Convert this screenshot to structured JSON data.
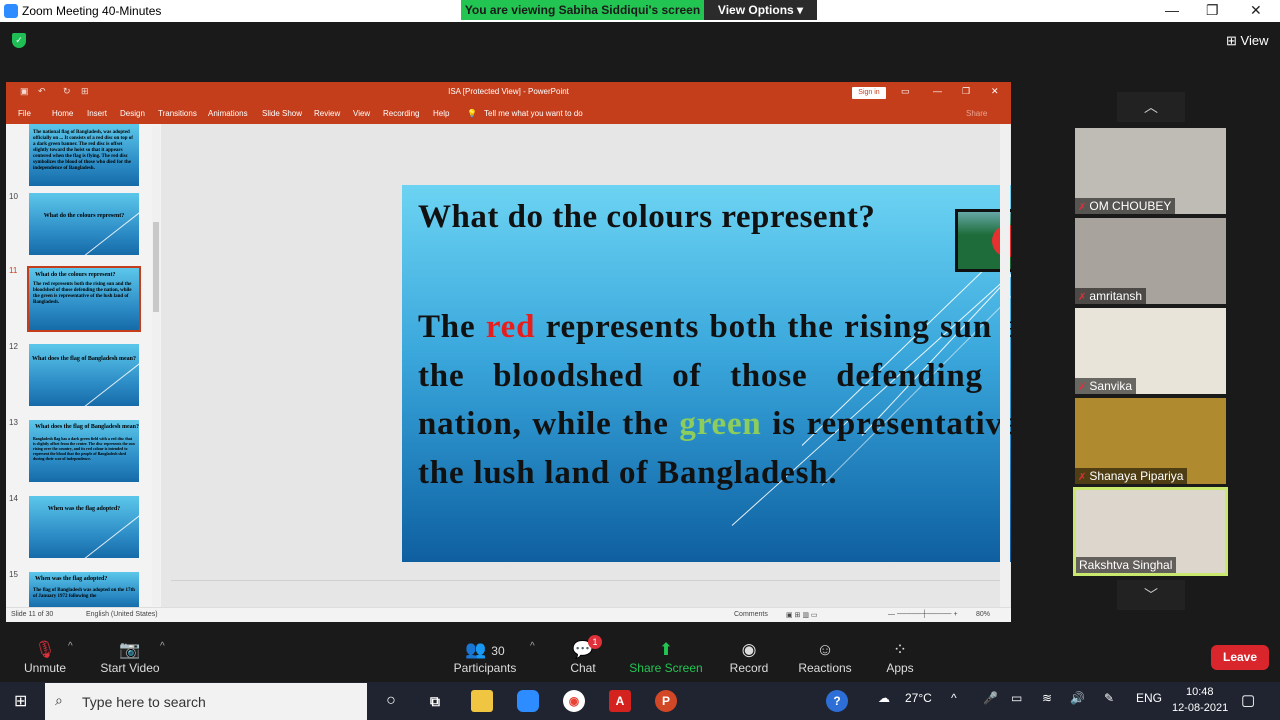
{
  "window": {
    "title": "Zoom Meeting 40-Minutes",
    "minimize": "—",
    "maximize": "❐",
    "close": "✕"
  },
  "share_banner": {
    "text": "You are viewing Sabiha Siddiqui's screen",
    "options": "View Options ▾"
  },
  "view_button": "View",
  "ppt": {
    "doc_title": "ISA [Protected View] - PowerPoint",
    "sign_in": "Sign in",
    "share": "Share",
    "menu": [
      "File",
      "Home",
      "Insert",
      "Design",
      "Transitions",
      "Animations",
      "Slide Show",
      "Review",
      "View",
      "Recording",
      "Help"
    ],
    "tell_me": "Tell me what you want to do",
    "thumbnails": [
      {
        "num": "",
        "title": "",
        "body": "The national flag of Bangladesh, was adopted officially on ... It consists of a red disc on top of a dark green banner. The red disc is offset slightly toward the hoist so that it appears centered when the flag is flying. The red disc symbolizes the blood of those who died for the independence of Bangladesh."
      },
      {
        "num": "10",
        "title": "What do the colours represent?",
        "body": ""
      },
      {
        "num": "11",
        "title": "What do the colours represent?",
        "body": "The red represents both the rising sun and the bloodshed of those defending the nation, while the green is representative of the lush land of Bangladesh."
      },
      {
        "num": "12",
        "title": "What does the flag of Bangladesh mean?",
        "body": ""
      },
      {
        "num": "13",
        "title": "What does the flag of Bangladesh mean?",
        "body": "Bangladesh flag has a dark green field with a red disc that is slightly offset from the center. The disc represents the sun rising over the country, and its red colour is intended to represent the blood that the people of Bangladesh shed during their war of independence."
      },
      {
        "num": "14",
        "title": "When was the flag adopted?",
        "body": ""
      },
      {
        "num": "15",
        "title": "When was the flag adopted?",
        "body": "The flag of Bangladesh was adopted on the 17th of January 1972 following the"
      }
    ],
    "slide": {
      "title": "What do the colours represent?",
      "body_pre": "The ",
      "word_red": "red",
      "body_mid": " represents both the rising sun and the bloodshed of those defending the nation, while the ",
      "word_green": "green",
      "body_post": " is representative of the lush land of Bangladesh."
    },
    "status": {
      "slide": "Slide 11 of 30",
      "lang": "English (United States)",
      "comments": "Comments",
      "zoom": "80%"
    }
  },
  "participants": [
    {
      "name": "OM CHOUBEY",
      "bg": "#bfbcb6"
    },
    {
      "name": "amritansh",
      "bg": "#a8a39c"
    },
    {
      "name": "Sanvika",
      "bg": "#e9e4da"
    },
    {
      "name": "Shanaya Pipariya",
      "bg": "#b08a2e"
    },
    {
      "name": "Rakshtva Singhal",
      "bg": "#dcd6cd"
    }
  ],
  "toolbar": {
    "unmute": "Unmute",
    "start_video": "Start Video",
    "participants": "Participants",
    "participants_count": "30",
    "chat": "Chat",
    "chat_badge": "1",
    "share_screen": "Share Screen",
    "record": "Record",
    "reactions": "Reactions",
    "apps": "Apps",
    "leave": "Leave"
  },
  "taskbar": {
    "search_placeholder": "Type here to search",
    "temp": "27°C",
    "lang": "ENG",
    "time": "10:48",
    "date": "12-08-2021"
  },
  "colors": {
    "ppt_red": "#c43e1c",
    "zoom_green": "#23c552",
    "leave_red": "#d8262c"
  }
}
